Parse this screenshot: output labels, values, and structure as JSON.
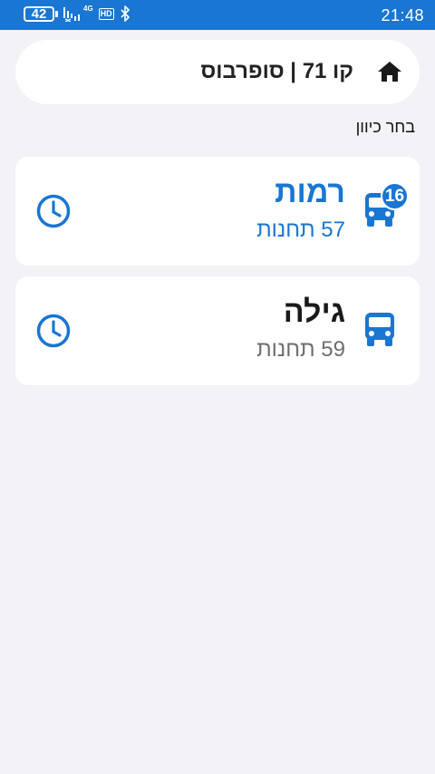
{
  "status_bar": {
    "battery": "42",
    "network": "4G",
    "hd": "HD",
    "time": "21:48"
  },
  "header": {
    "title": "קו 71 | סופרבוס"
  },
  "section_label": "בחר כיוון",
  "directions": [
    {
      "name": "רמות",
      "stops": "57 תחנות",
      "badge": "16",
      "active": true
    },
    {
      "name": "גילה",
      "stops": "59 תחנות"
    }
  ],
  "colors": {
    "accent": "#1976d2",
    "background": "#f2f2f7",
    "card": "#ffffff",
    "muted_text": "#6e6e6e"
  },
  "icons": {
    "home": "home-icon",
    "bus": "bus-icon",
    "schedule": "clock-icon"
  }
}
